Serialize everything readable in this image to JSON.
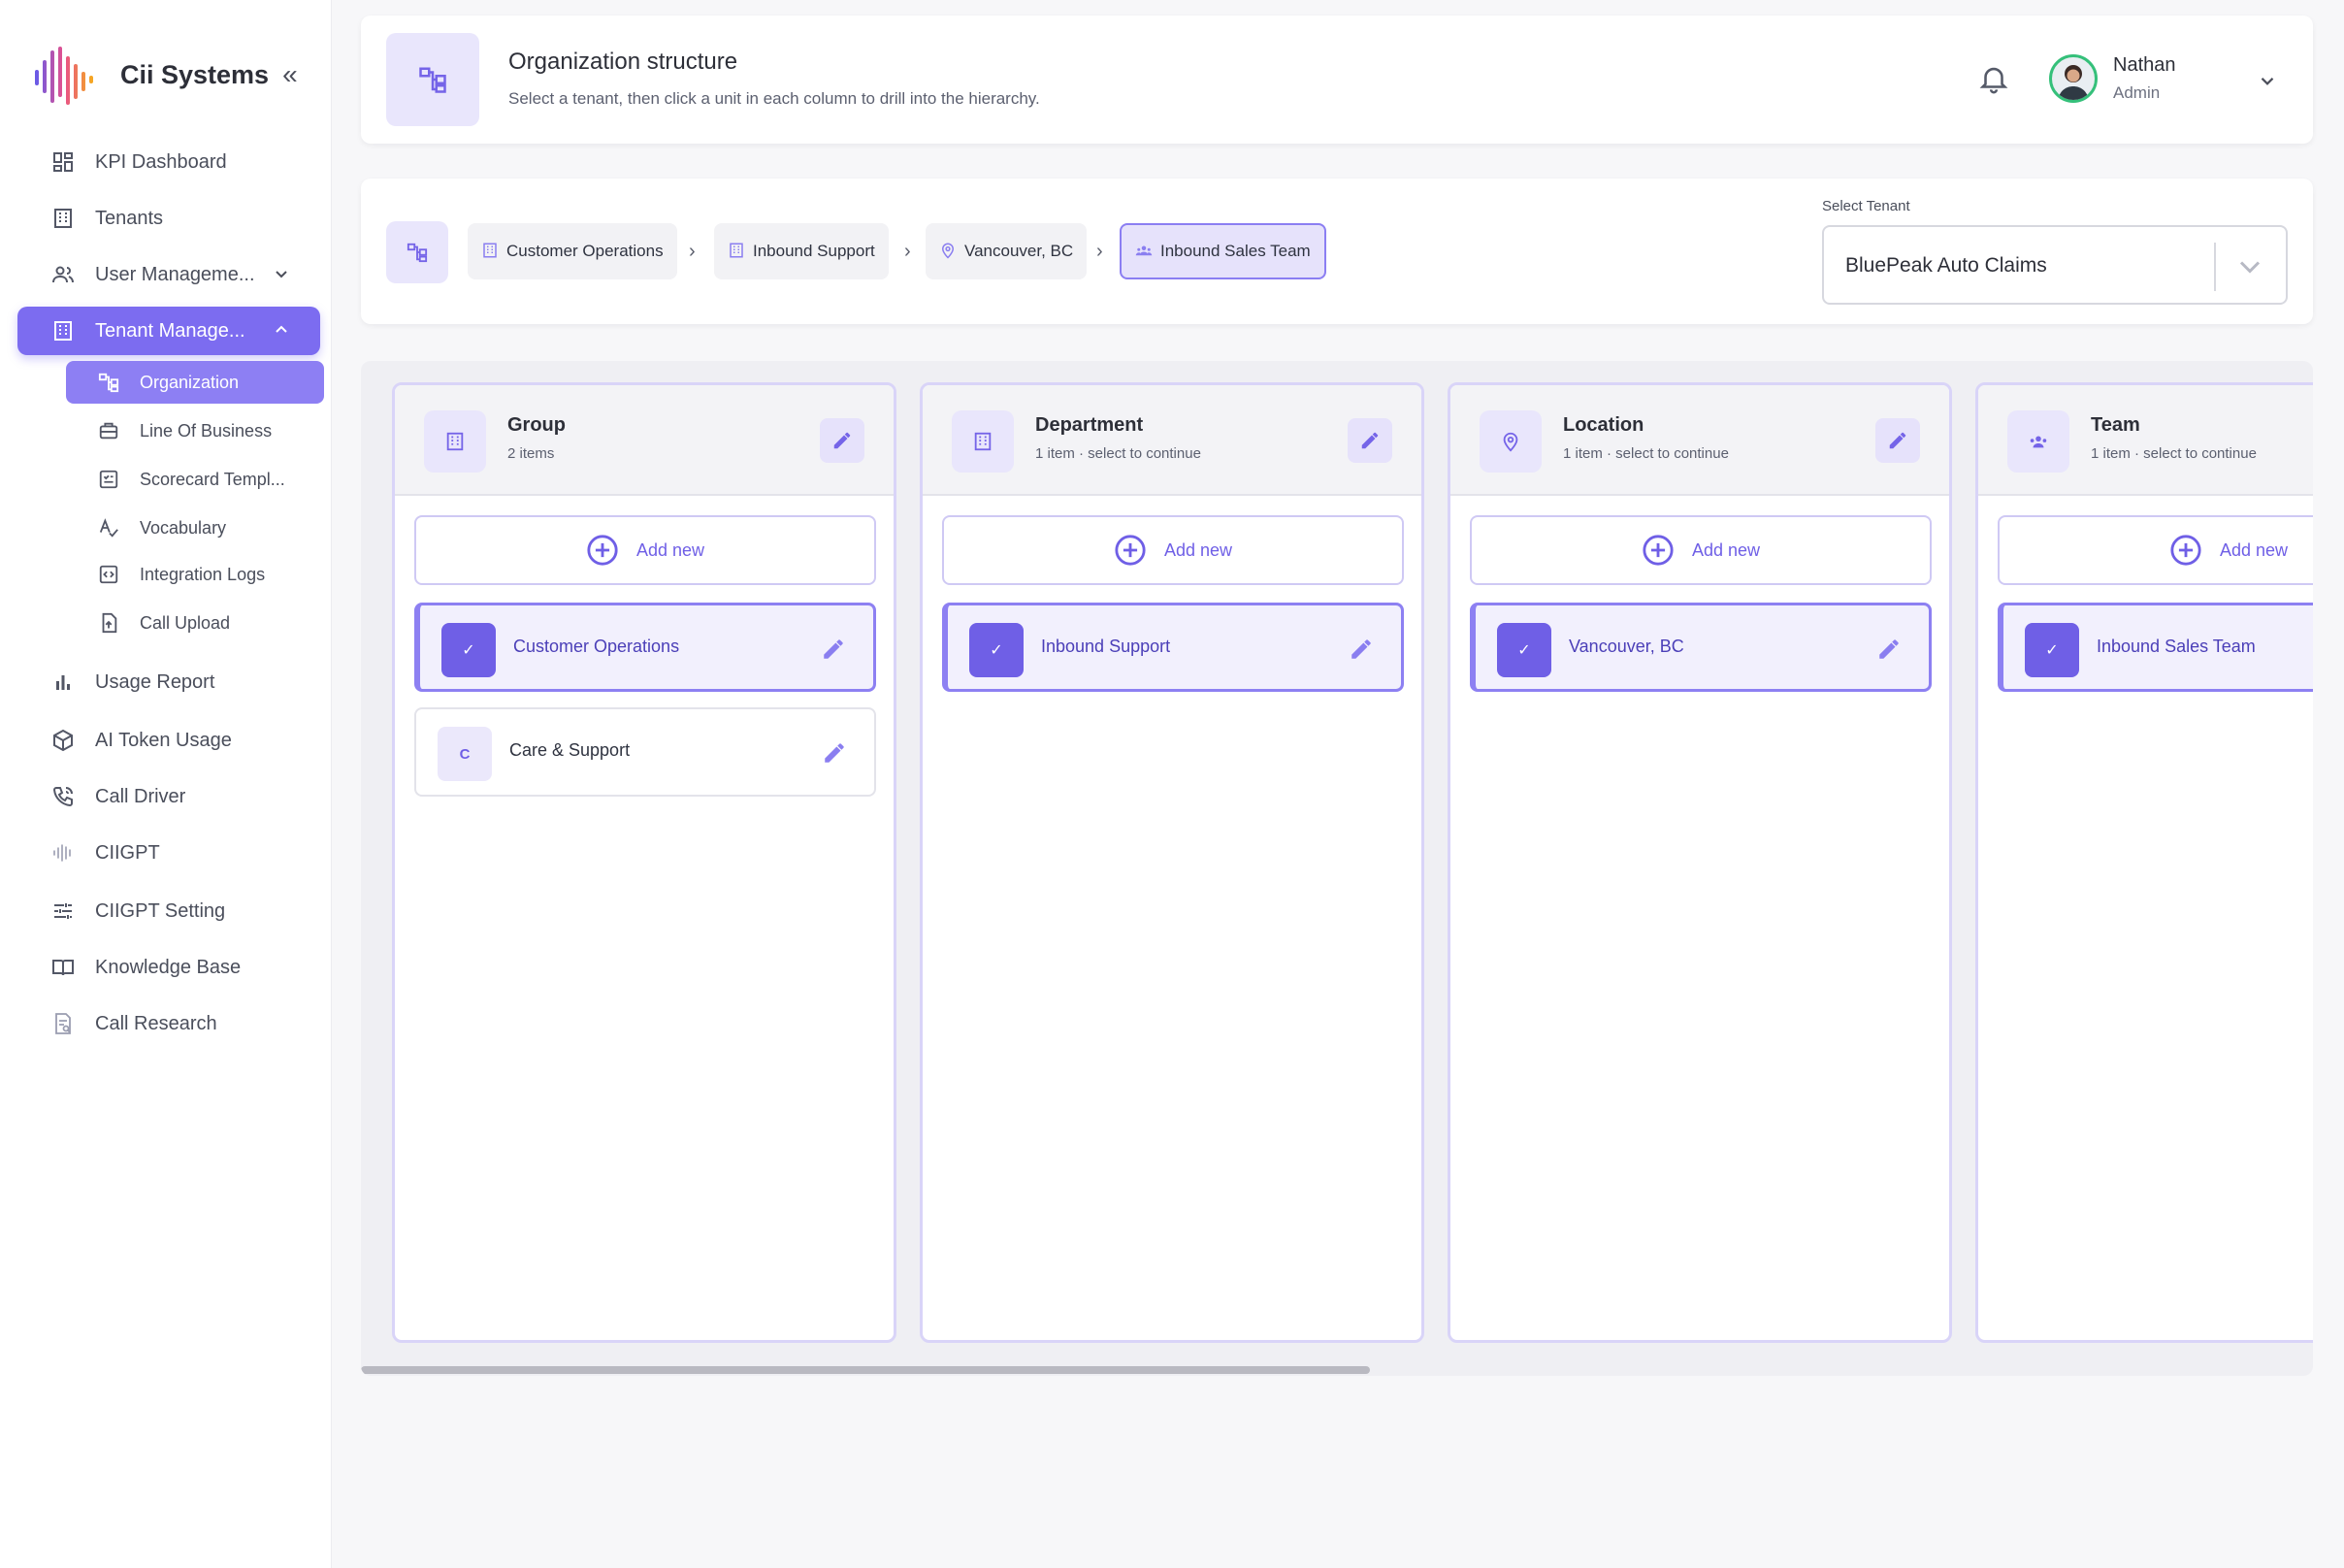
{
  "brand": {
    "name": "Cii Systems",
    "collapse": "«"
  },
  "sidebar": {
    "items": [
      {
        "label": "KPI Dashboard",
        "icon": "dashboard-icon"
      },
      {
        "label": "Tenants",
        "icon": "building-icon"
      },
      {
        "label": "User Manageme...",
        "icon": "users-icon"
      },
      {
        "label": "Tenant Manage...",
        "icon": "building-icon"
      },
      {
        "label": "Usage Report",
        "icon": "bar-chart-icon"
      },
      {
        "label": "AI Token Usage",
        "icon": "cube-icon"
      },
      {
        "label": "Call Driver",
        "icon": "phone-icon"
      },
      {
        "label": "CIIGPT",
        "icon": "waveform-icon"
      },
      {
        "label": "CIIGPT Setting",
        "icon": "sliders-icon"
      },
      {
        "label": "Knowledge Base",
        "icon": "book-icon"
      },
      {
        "label": "Call Research",
        "icon": "document-search-icon"
      }
    ],
    "sub_items": [
      {
        "label": "Organization"
      },
      {
        "label": "Line Of Business"
      },
      {
        "label": "Scorecard Templ..."
      },
      {
        "label": "Vocabulary"
      },
      {
        "label": "Integration Logs"
      },
      {
        "label": "Call Upload"
      }
    ]
  },
  "header": {
    "title": "Organization structure",
    "subtitle": "Select a tenant, then click a unit in each column to drill into the hierarchy.",
    "user_name": "Nathan",
    "user_role": "Admin"
  },
  "breadcrumb": {
    "items": [
      {
        "label": "Customer Operations",
        "icon": "building-icon"
      },
      {
        "label": "Inbound Support",
        "icon": "building-icon"
      },
      {
        "label": "Vancouver, BC",
        "icon": "location-pin-icon"
      },
      {
        "label": "Inbound Sales Team",
        "icon": "team-icon"
      }
    ],
    "separator": "›"
  },
  "tenant": {
    "label": "Select Tenant",
    "value": "BluePeak Auto Claims"
  },
  "columns": [
    {
      "title": "Group",
      "subtitle": "2 items",
      "add_label": "Add new",
      "items": [
        {
          "label": "Customer Operations",
          "badge": "✓",
          "selected": true
        },
        {
          "label": "Care & Support",
          "badge": "C",
          "selected": false
        }
      ]
    },
    {
      "title": "Department",
      "subtitle": "1 item · select to continue",
      "add_label": "Add new",
      "items": [
        {
          "label": "Inbound Support",
          "badge": "✓",
          "selected": true
        }
      ]
    },
    {
      "title": "Location",
      "subtitle": "1 item · select to continue",
      "add_label": "Add new",
      "items": [
        {
          "label": "Vancouver, BC",
          "badge": "✓",
          "selected": true
        }
      ]
    },
    {
      "title": "Team",
      "subtitle": "1 item · select to continue",
      "add_label": "Add new",
      "items": [
        {
          "label": "Inbound Sales Team",
          "badge": "✓",
          "selected": true
        }
      ]
    }
  ],
  "colors": {
    "accent": "#7c6cf0",
    "accent_light": "#e9e6fc",
    "online": "#35c07a"
  }
}
